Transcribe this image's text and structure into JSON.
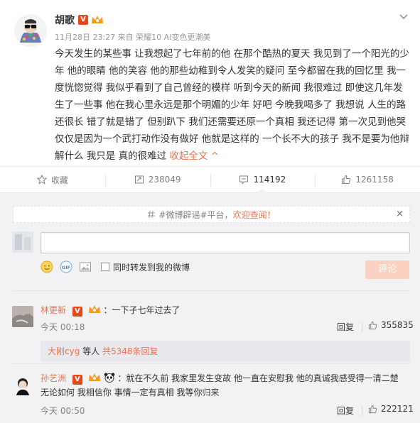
{
  "post": {
    "author": "胡歌",
    "meta": "11月28日 23:27 来自 荣耀10 AI变色更潮美",
    "text": "今天发生的某些事 让我想起了七年前的他 在那个酷热的夏天 我见到了一个阳光的少年 他的眼睛 他的笑容 他的那些幼稚到令人发笑的疑问 至今都留在我的回忆里 我一度恍惚觉得 我似乎看到了自己曾经的模样 听到今天的新闻 我很难过 即使这几年发生了一些事 他在我心里永远是那个明媚的少年 好吧 今晚我喝多了 我想说 人生的路还很长 错了就是错了 但别趴下 我们还需要还原一个真相 我还记得 第一次见到他哭 仅仅是因为一个武打动作没有做好 他就是这样的 一个长不大的孩子 我不是要为他辩解什么 我只是 真的很难过",
    "collapse_label": "收起全文 ^",
    "verified_badge": "V"
  },
  "actions": {
    "favorite": "收藏",
    "repost": "238049",
    "comment": "114192",
    "like": "1261158"
  },
  "notice": {
    "tag": "#微博辟谣#",
    "text_main": "平台，",
    "text_highlight": "欢迎查阅！",
    "close": "×"
  },
  "composer": {
    "forward_label": "同时转发到我的微博",
    "submit_label": "评论"
  },
  "comments": [
    {
      "user": "林更新",
      "content": "：一下子七年过去了",
      "time": "今天 00:18",
      "reply_label": "回复",
      "likes": "355835"
    },
    {
      "user": "孙艺洲",
      "content": "：就在不久前 我家里发生变故 他一直在安慰我 他的真诚我感受得一清二楚 无论如何 我相信你 事情一定有真相 我等你归来",
      "time": "今天 00:50",
      "reply_label": "回复",
      "likes": "222121"
    }
  ],
  "sub_replies": {
    "user": "大刚cyg",
    "text": " 等人 ",
    "count": "共5348条回复"
  },
  "colors": {
    "accent": "#eb7350",
    "vip_red": "#e8461b",
    "comment_bg": "#f2f2f5"
  }
}
